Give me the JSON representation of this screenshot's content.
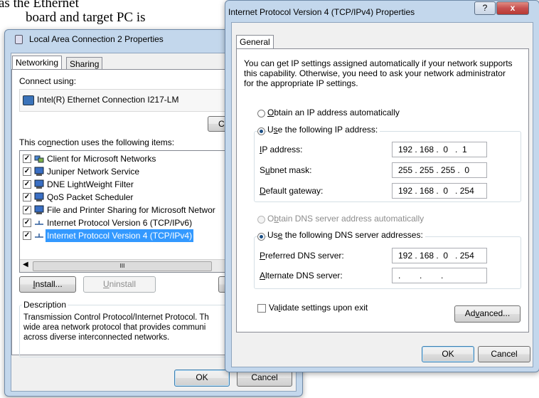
{
  "background_text": {
    "line1": "as the Ethernet",
    "line2": "board and target PC is"
  },
  "lac": {
    "title": "Local Area Connection 2 Properties",
    "tabs": [
      "Networking",
      "Sharing"
    ],
    "connect_using_label": "Connect using:",
    "adapter_name": "Intel(R) Ethernet Connection I217-LM",
    "configure_label": "C",
    "items_label": "This connection uses the following items:",
    "items": [
      {
        "label": "Client for Microsoft Networks",
        "checked": true,
        "icon": "network-client-icon"
      },
      {
        "label": "Juniper Network Service",
        "checked": true,
        "icon": "network-service-icon"
      },
      {
        "label": "DNE LightWeight Filter",
        "checked": true,
        "icon": "network-service-icon"
      },
      {
        "label": "QoS Packet Scheduler",
        "checked": true,
        "icon": "network-service-icon"
      },
      {
        "label": "File and Printer Sharing for Microsoft Networ",
        "checked": true,
        "icon": "network-service-icon"
      },
      {
        "label": "Internet Protocol Version 6 (TCP/IPv6)",
        "checked": true,
        "icon": "protocol-icon"
      },
      {
        "label": "Internet Protocol Version 4 (TCP/IPv4)",
        "checked": true,
        "icon": "protocol-icon",
        "selected": true
      }
    ],
    "scroll_marker": "III",
    "install_label": "Install...",
    "uninstall_label": "Uninstall",
    "properties_label": "P",
    "description_title": "Description",
    "description_lines": [
      "Transmission Control Protocol/Internet Protocol. Th",
      "wide area network protocol that provides communi",
      "across diverse interconnected networks."
    ],
    "ok_label": "OK",
    "cancel_label": "Cancel"
  },
  "ipv4": {
    "title": "Internet Protocol Version 4 (TCP/IPv4) Properties",
    "help_label": "?",
    "close_label": "x",
    "tab": "General",
    "intro_lines": [
      "You can get IP settings assigned automatically if your network supports",
      "this capability. Otherwise, you need to ask your network administrator",
      "for the appropriate IP settings."
    ],
    "obtain_ip_auto": "Obtain an IP address automatically",
    "use_following_ip": "Use the following IP address:",
    "ip_address_label": "IP address:",
    "ip_address_value": "192 . 168 .  0   .  1",
    "subnet_label": "Subnet mask:",
    "subnet_value": "255 . 255 . 255 .  0",
    "gateway_label": "Default gateway:",
    "gateway_value": "192 . 168 .  0   . 254",
    "obtain_dns_auto": "Obtain DNS server address automatically",
    "use_following_dns": "Use the following DNS server addresses:",
    "preferred_dns_label": "Preferred DNS server:",
    "preferred_dns_value": "192 . 168 .  0   . 254",
    "alternate_dns_label": "Alternate DNS server:",
    "alternate_dns_value": ".        .        .",
    "validate_label": "Validate settings upon exit",
    "advanced_label": "Advanced...",
    "ok_label": "OK",
    "cancel_label": "Cancel"
  },
  "colors": {
    "frame": "#c3d7ec",
    "selection": "#3399ff",
    "close_button": "#c75050"
  }
}
